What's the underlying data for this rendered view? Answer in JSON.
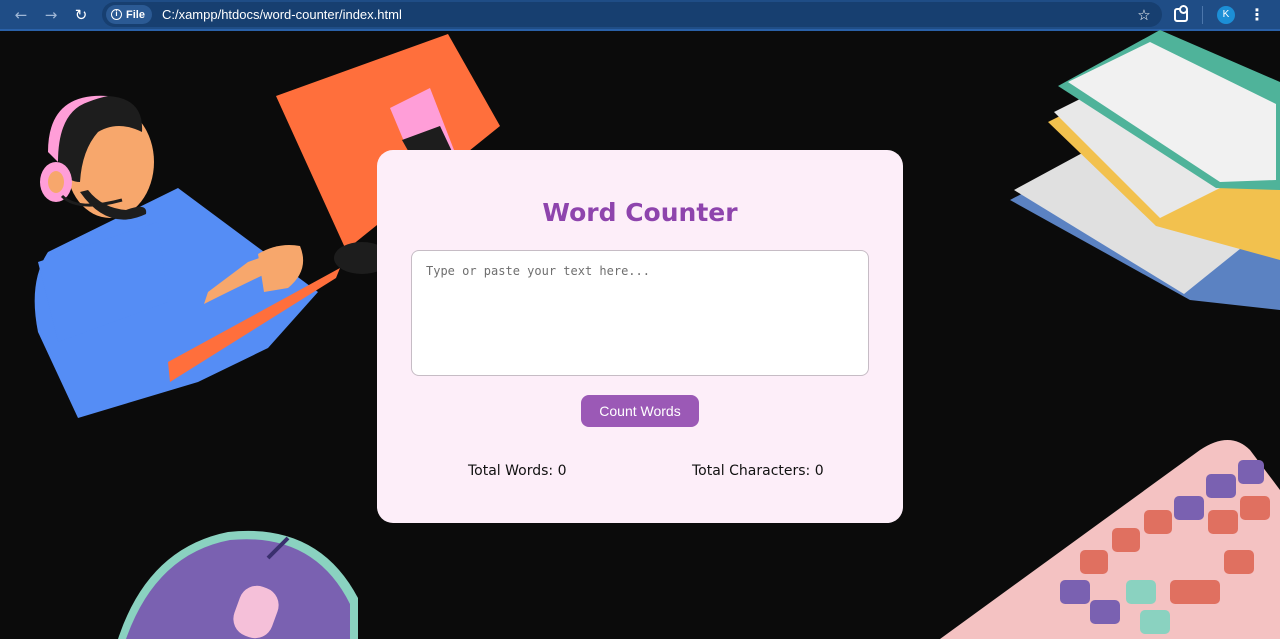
{
  "browser": {
    "back_icon": "←",
    "forward_icon": "→",
    "reload_icon": "↻",
    "scheme_label": "File",
    "url": "C:/xampp/htdocs/word-counter/index.html",
    "bookmark_icon": "☆",
    "profile_initial": "K",
    "menu_icon": "⋮"
  },
  "app": {
    "title": "Word Counter",
    "textarea_placeholder": "Type or paste your text here...",
    "textarea_value": "",
    "count_button_label": "Count Words",
    "total_words_label": "Total Words:",
    "total_words_value": "0",
    "total_chars_label": "Total Characters:",
    "total_chars_value": "0"
  },
  "colors": {
    "card_background": "#fdeef9",
    "accent": "#8e44ad",
    "button": "#9b59b6",
    "page_background": "#0b0b0b",
    "browser_bar": "#1f4d86"
  }
}
